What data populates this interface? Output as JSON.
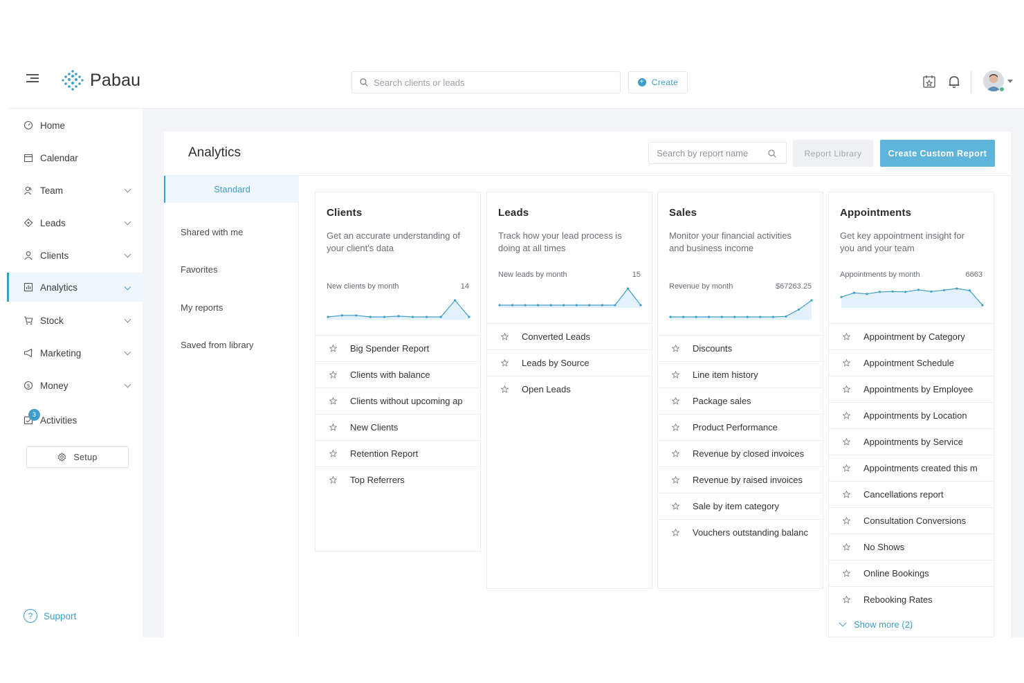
{
  "app": {
    "name": "Pabau"
  },
  "header": {
    "search_placeholder": "Search clients or leads",
    "create_label": "Create"
  },
  "sidebar": {
    "items": [
      {
        "label": "Home",
        "icon": "home-icon",
        "has_chevron": false
      },
      {
        "label": "Calendar",
        "icon": "calendar-icon",
        "has_chevron": false
      },
      {
        "label": "Team",
        "icon": "team-icon",
        "has_chevron": true
      },
      {
        "label": "Leads",
        "icon": "leads-icon",
        "has_chevron": true
      },
      {
        "label": "Clients",
        "icon": "clients-icon",
        "has_chevron": true
      },
      {
        "label": "Analytics",
        "icon": "analytics-icon",
        "has_chevron": true,
        "active": true
      },
      {
        "label": "Stock",
        "icon": "cart-icon",
        "has_chevron": true
      },
      {
        "label": "Marketing",
        "icon": "megaphone-icon",
        "has_chevron": true
      },
      {
        "label": "Money",
        "icon": "money-icon",
        "has_chevron": true
      },
      {
        "label": "Activities",
        "icon": "activities-icon",
        "has_chevron": false,
        "badge": "3"
      }
    ],
    "setup_label": "Setup",
    "support_label": "Support"
  },
  "page": {
    "title": "Analytics",
    "report_search_placeholder": "Search by report name",
    "library_button": "Report Library",
    "custom_button": "Create Custom Report",
    "tabs": [
      "Standard",
      "Shared with me",
      "Favorites",
      "My reports",
      "Saved from library"
    ]
  },
  "cards": [
    {
      "title": "Clients",
      "description": "Get an accurate understanding of your client's data",
      "spark_label": "New clients by month",
      "spark_value": "14",
      "spark": [
        3,
        4,
        4,
        3,
        3,
        3.5,
        3,
        3,
        3,
        14,
        3
      ],
      "reports": [
        "Big Spender Report",
        "Clients with balance",
        "Clients without upcoming ap",
        "New Clients",
        "Retention Report",
        "Top Referrers"
      ]
    },
    {
      "title": "Leads",
      "description": "Track how your lead process is doing at all times",
      "spark_label": "New leads by month",
      "spark_value": "15",
      "spark": [
        1,
        1,
        1,
        1,
        1,
        1,
        1,
        1,
        1,
        1,
        15,
        1
      ],
      "reports": [
        "Converted Leads",
        "Leads by Source",
        "Open Leads"
      ]
    },
    {
      "title": "Sales",
      "description": "Monitor your financial activities and business income",
      "spark_label": "Revenue by month",
      "spark_value": "$67263.25",
      "spark": [
        0,
        0,
        0,
        0,
        0,
        0,
        0,
        0,
        0,
        2000,
        30000,
        67263.25
      ],
      "reports": [
        "Discounts",
        "Line item history",
        "Package sales",
        "Product Performance",
        "Revenue by closed invoices",
        "Revenue by raised invoices",
        "Sale by item category",
        "Vouchers outstanding balanc"
      ]
    },
    {
      "title": "Appointments",
      "description": "Get key appointment insight for you and your team",
      "spark_label": "Appointments by month",
      "spark_value": "6663",
      "spark": [
        4200,
        5400,
        5100,
        5700,
        5800,
        5700,
        6300,
        5800,
        6200,
        6663,
        6100,
        1800
      ],
      "reports": [
        "Appointment by Category",
        "Appointment Schedule",
        "Appointments by Employee",
        "Appointments by Location",
        "Appointments by Service",
        "Appointments created this m",
        "Cancellations report",
        "Consultation Conversions",
        "No Shows",
        "Online Bookings",
        "Rebooking Rates"
      ],
      "show_more": "Show more (2)"
    }
  ],
  "colors": {
    "accent": "#3e9ec9",
    "button": "#5fb4da",
    "spark_fill": "#e3f1fa"
  }
}
